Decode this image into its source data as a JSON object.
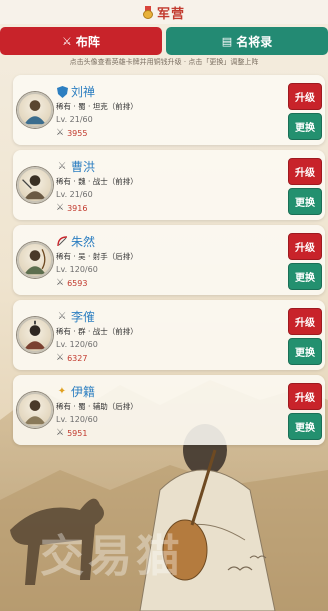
{
  "header": {
    "title": "军营",
    "icon": "medal-icon"
  },
  "tabs": [
    {
      "label": "布阵",
      "icon": "crossed-swords-icon",
      "color": "#c8232a",
      "active": true
    },
    {
      "label": "名将录",
      "icon": "book-icon",
      "color": "#238a73",
      "active": false
    }
  ],
  "hint": "点击头像查看英雄卡牌并用铜钱升级 · 点击「更换」调整上阵",
  "heroes": [
    {
      "name": "刘禅",
      "badge": "shield",
      "meta": "稀有 · 蜀 · 坦克（前排）",
      "level": "Lv. 21/60",
      "power": "3955"
    },
    {
      "name": "曹洪",
      "badge": "swords",
      "meta": "稀有 · 魏 · 战士（前排）",
      "level": "Lv. 21/60",
      "power": "3916"
    },
    {
      "name": "朱然",
      "badge": "bow",
      "meta": "稀有 · 吴 · 射手（后排）",
      "level": "Lv. 120/60",
      "power": "6593"
    },
    {
      "name": "李傕",
      "badge": "swords",
      "meta": "稀有 · 群 · 战士（前排）",
      "level": "Lv. 120/60",
      "power": "6327"
    },
    {
      "name": "伊籍",
      "badge": "sparkle",
      "meta": "稀有 · 蜀 · 辅助（后排）",
      "level": "Lv. 120/60",
      "power": "5951"
    }
  ],
  "buttons": {
    "upgrade": "升级",
    "swap": "更换"
  },
  "colors": {
    "accent_red": "#c8232a",
    "accent_teal": "#238a73",
    "name_blue": "#2d7fc1",
    "power_red": "#c23a2e"
  }
}
